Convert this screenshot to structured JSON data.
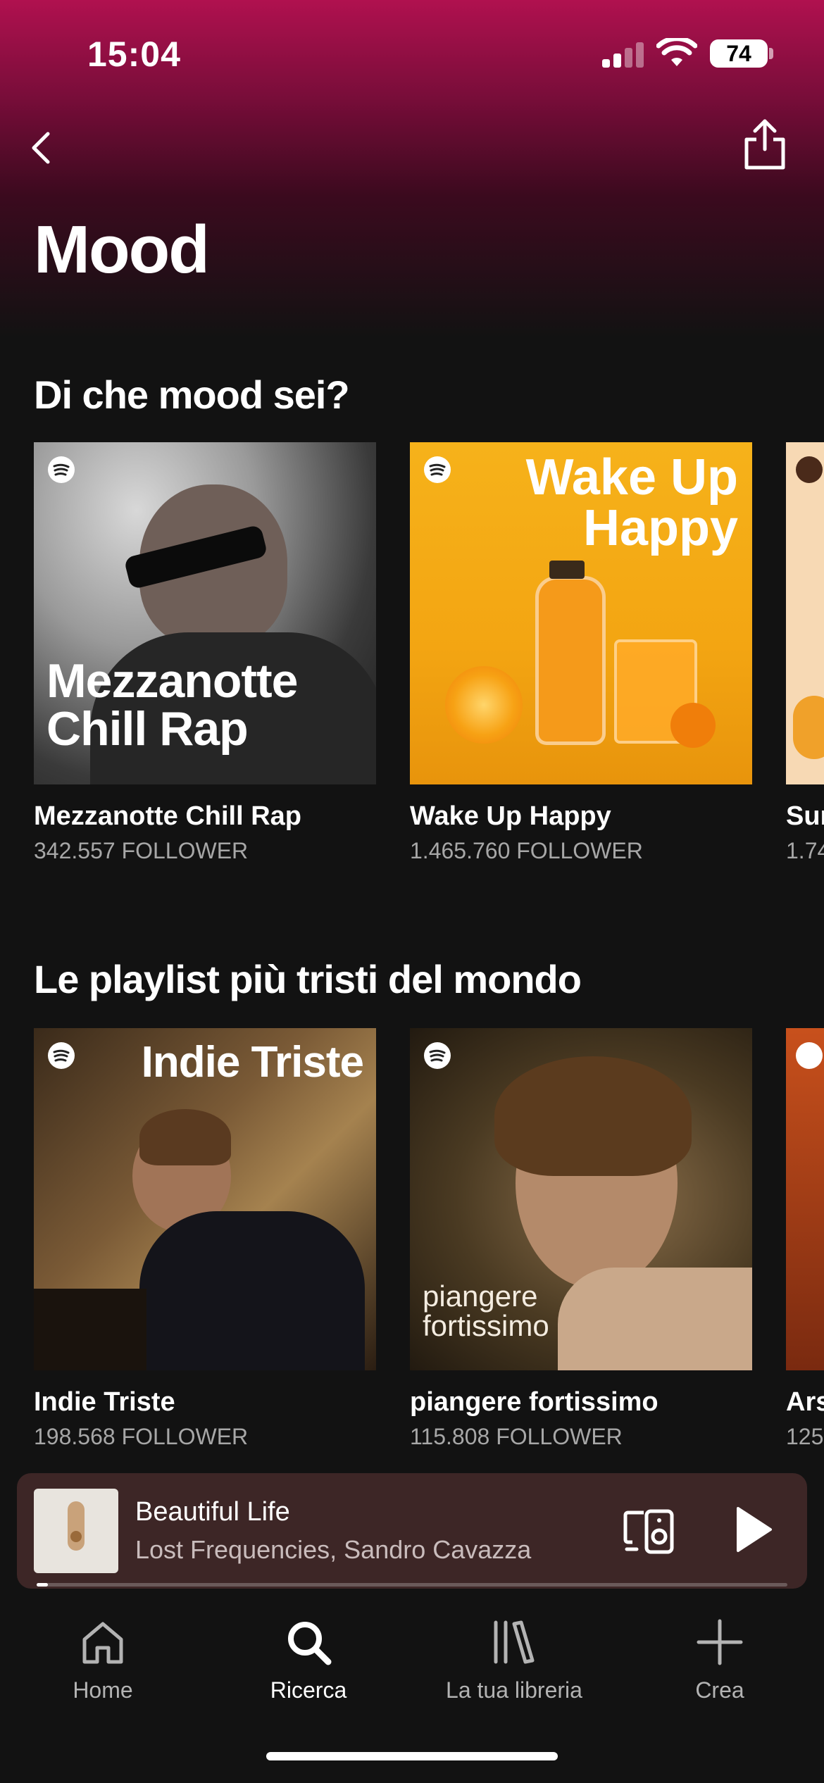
{
  "status_bar": {
    "time": "15:04",
    "battery": "74"
  },
  "header": {
    "title": "Mood"
  },
  "sections": [
    {
      "title": "Di che mood sei?",
      "cards": [
        {
          "title": "Mezzanotte Chill Rap",
          "followers": "342.557 FOLLOWER",
          "cover_text": "Mezzanotte Chill Rap"
        },
        {
          "title": "Wake Up Happy",
          "followers": "1.465.760 FOLLOWER",
          "cover_text": "Wake Up Happy"
        },
        {
          "title": "Sur",
          "followers": "1.74"
        }
      ]
    },
    {
      "title": "Le playlist più tristi del mondo",
      "cards": [
        {
          "title": "Indie Triste",
          "followers": "198.568 FOLLOWER",
          "cover_text": "Indie Triste"
        },
        {
          "title": "piangere fortissimo",
          "followers": "115.808 FOLLOWER",
          "cover_text": "piangere fortissimo"
        },
        {
          "title": "Ars",
          "followers": "125."
        }
      ]
    }
  ],
  "mini_player": {
    "title": "Beautiful Life",
    "artist": "Lost Frequencies, Sandro Cavazza",
    "progress": 0.015
  },
  "bottom_nav": [
    {
      "label": "Home",
      "icon": "home-icon"
    },
    {
      "label": "Ricerca",
      "icon": "search-icon",
      "active": true
    },
    {
      "label": "La tua libreria",
      "icon": "library-icon"
    },
    {
      "label": "Crea",
      "icon": "plus-icon"
    }
  ],
  "colors": {
    "accent": "#b0114f",
    "background": "#121212",
    "mini_player": "#3d2626"
  }
}
